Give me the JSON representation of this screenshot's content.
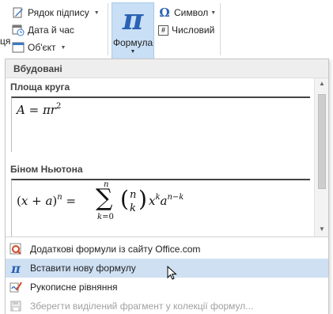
{
  "ribbon": {
    "left_cut_label": "ця",
    "signature_line": "Рядок підпису",
    "date_time": "Дата й час",
    "object": "Об'єкт",
    "equation_symbol": "π",
    "equation": "Формула",
    "symbol": "Символ",
    "symbol_glyph": "Ω",
    "number": "Числовий",
    "number_glyph": "#"
  },
  "gallery": {
    "header": "Вбудовані",
    "items": [
      {
        "title": "Площа круга",
        "formula": "A = πr²"
      },
      {
        "title": "Біном Ньютона",
        "formula": "(x + a)ⁿ = Σ (n k) xᵏ aⁿ⁻ᵏ"
      }
    ]
  },
  "menu_items": [
    {
      "label": "Додаткові формули із сайту Office.com",
      "icon": "office-formulas-icon",
      "state": "normal"
    },
    {
      "label": "Вставити нову формулу",
      "icon": "pi-icon",
      "state": "hover"
    },
    {
      "label": "Рукописне рівняння",
      "icon": "ink-equation-icon",
      "state": "normal"
    },
    {
      "label": "Зберегти виділений фрагмент у колекції формул...",
      "icon": "save-selection-icon",
      "state": "disabled"
    }
  ],
  "colors": {
    "accent_blue": "#2b63b4",
    "selected_button_bg": "#c9dff5",
    "hover_item_bg": "#cfe0f3",
    "disabled_text": "#a0a0a0"
  }
}
